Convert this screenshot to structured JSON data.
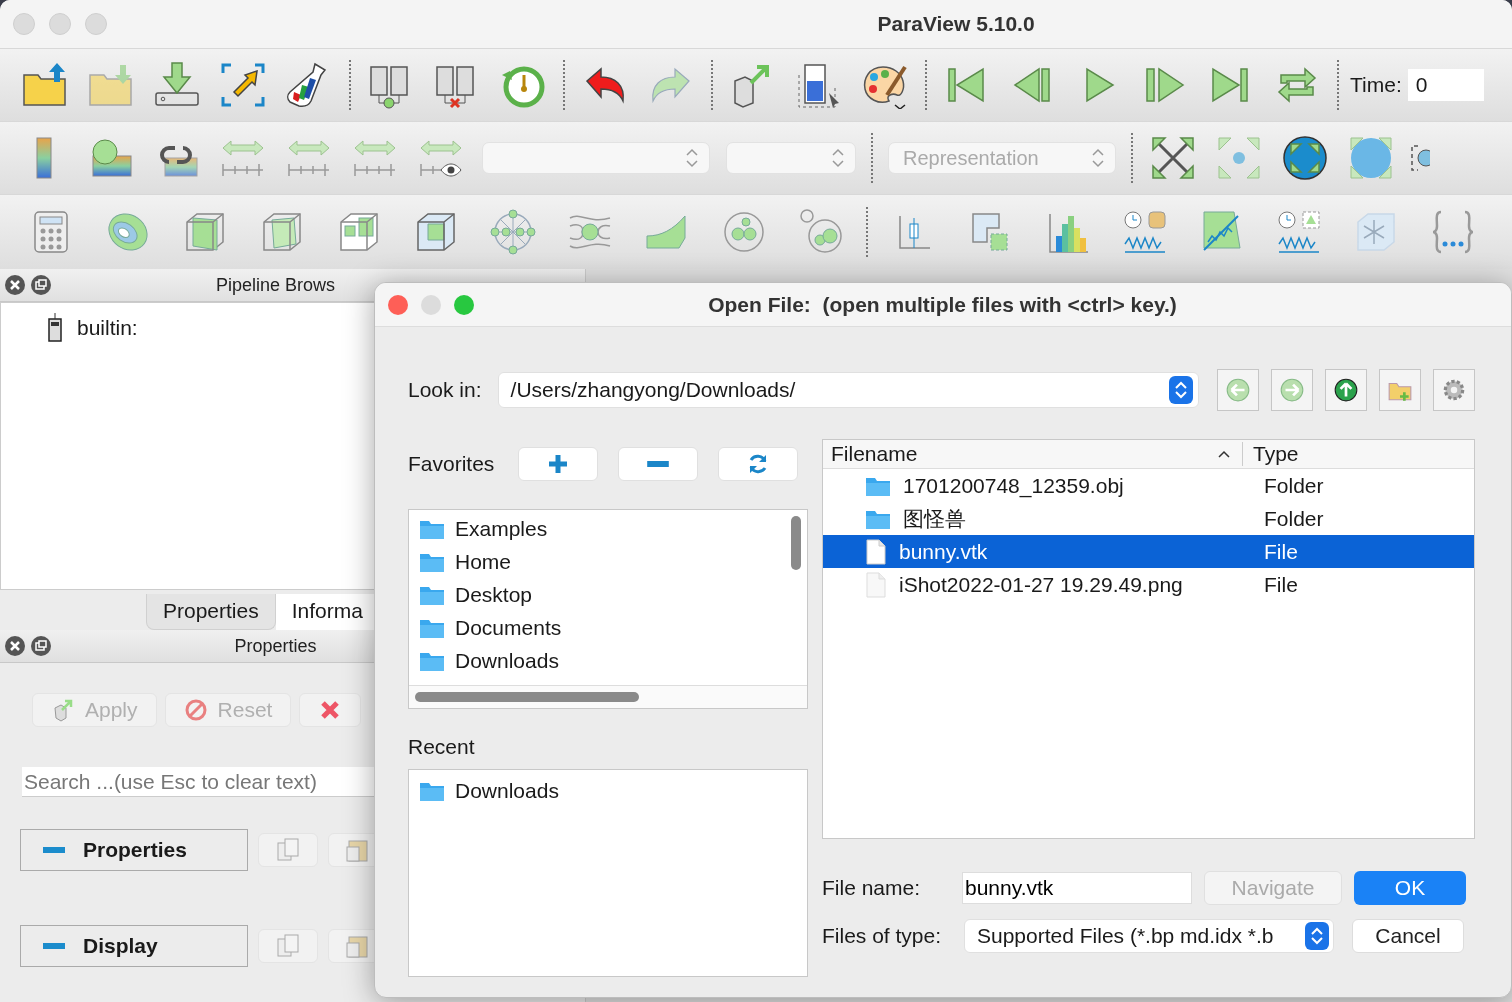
{
  "window": {
    "title": "ParaView 5.10.0"
  },
  "toolbar": {
    "representation_combo": {
      "value": "Representation",
      "disabled": true
    },
    "time_label": "Time:",
    "time_value": "0"
  },
  "pipeline_browser": {
    "title": "Pipeline Brows",
    "items": [
      {
        "label": "builtin:"
      }
    ]
  },
  "panel_tabs": [
    {
      "label": "Properties",
      "selected": true
    },
    {
      "label": "Informa",
      "selected": false
    }
  ],
  "properties_panel": {
    "title": "Properties",
    "buttons": [
      {
        "label": "Apply",
        "kind": "apply",
        "disabled": true
      },
      {
        "label": "Reset",
        "kind": "reset",
        "disabled": true
      },
      {
        "kind": "delete"
      }
    ],
    "search": {
      "placeholder": "Search ...(use Esc to clear text)"
    },
    "sections": [
      {
        "label": "Properties",
        "expanded": true
      },
      {
        "label": "Display",
        "expanded": true
      }
    ]
  },
  "dialog": {
    "title": "Open File:  (open multiple files with <ctrl> key.)",
    "look_in": {
      "label": "Look in:",
      "value": "/Users/zhangyong/Downloads/"
    },
    "favorites": {
      "label": "Favorites",
      "items": [
        {
          "label": "Examples"
        },
        {
          "label": "Home"
        },
        {
          "label": "Desktop"
        },
        {
          "label": "Documents"
        },
        {
          "label": "Downloads"
        }
      ]
    },
    "recent": {
      "label": "Recent",
      "items": [
        {
          "label": "Downloads"
        }
      ]
    },
    "files": {
      "columns": [
        "Filename",
        "Type"
      ],
      "rows": [
        {
          "name": "1701200748_12359.obj",
          "type": "Folder",
          "kind": "folder",
          "selected": false
        },
        {
          "name": "图怪兽",
          "type": "Folder",
          "kind": "folder",
          "selected": false
        },
        {
          "name": "bunny.vtk",
          "type": "File",
          "kind": "file",
          "selected": true
        },
        {
          "name": "iShot2022-01-27 19.29.49.png",
          "type": "File",
          "kind": "image",
          "selected": false
        }
      ]
    },
    "file_name": {
      "label": "File name:",
      "value": "bunny.vtk"
    },
    "navigate_button": {
      "label": "Navigate",
      "disabled": true
    },
    "ok_button": {
      "label": "OK"
    },
    "files_of_type": {
      "label": "Files of type:",
      "value": "Supported Files (*.bp md.idx *.b"
    },
    "cancel_button": {
      "label": "Cancel"
    }
  }
}
